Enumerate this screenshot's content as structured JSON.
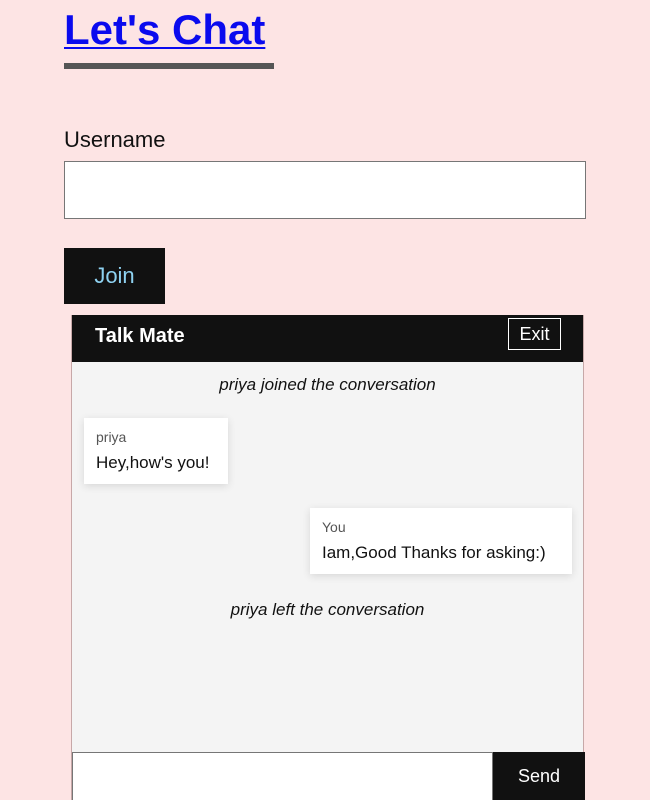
{
  "page": {
    "title": "Let's Chat"
  },
  "login": {
    "username_label": "Username",
    "username_value": "",
    "join_label": "Join"
  },
  "chat": {
    "header_title": "Talk Mate",
    "exit_label": "Exit",
    "events": {
      "joined": "priya joined the conversation",
      "left": "priya left the conversation"
    },
    "messages": [
      {
        "sender": "priya",
        "text": "Hey,how's you!",
        "direction": "incoming"
      },
      {
        "sender": "You",
        "text": "Iam,Good Thanks for asking:)",
        "direction": "outgoing"
      }
    ],
    "composer": {
      "value": "",
      "send_label": "Send"
    }
  },
  "colors": {
    "background": "#fde4e4",
    "title": "#0a0aee",
    "dark": "#111111",
    "join_text": "#8ed1f0",
    "chat_bg": "#f4f4f4"
  }
}
